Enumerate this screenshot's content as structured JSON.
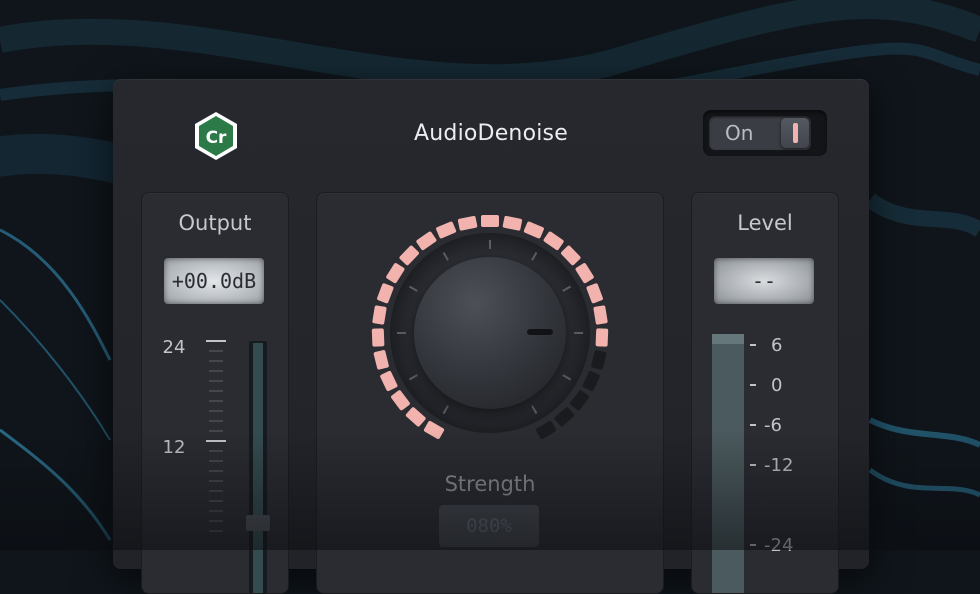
{
  "plugin": {
    "title": "AudioDenoise",
    "logo_text": "Cr",
    "power": {
      "label": "On",
      "state": "on"
    }
  },
  "output": {
    "label": "Output",
    "value": "+00.0dB",
    "scale": [
      "24",
      "12"
    ],
    "fader_level": 0.03
  },
  "strength": {
    "label": "Strength",
    "value": "080%",
    "amount": 0.8
  },
  "level": {
    "label": "Level",
    "value": "--",
    "scale": [
      "6",
      "0",
      "-6",
      "-12",
      "-24"
    ]
  },
  "colors": {
    "accent": "#f2b3ae",
    "panel": "#26282e",
    "logo_green": "#2c7a47"
  }
}
